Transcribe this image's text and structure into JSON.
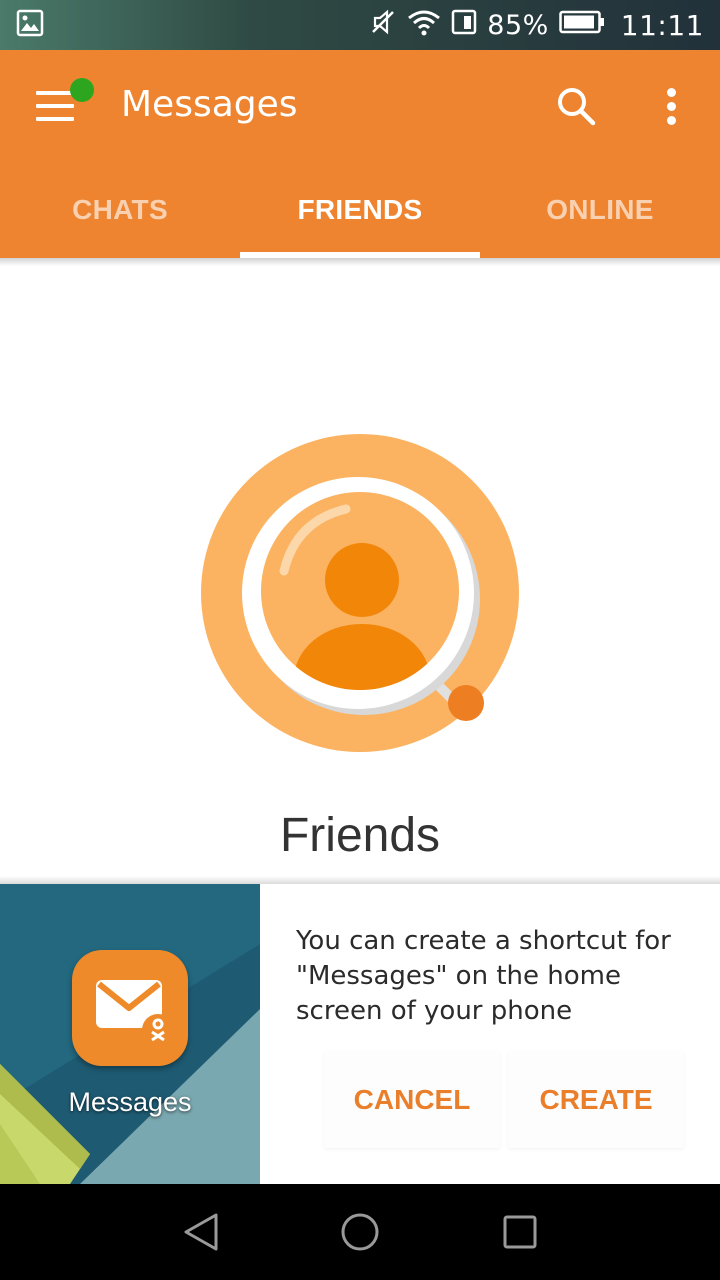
{
  "status_bar": {
    "battery_percent": "85%",
    "time": "11:11",
    "icons": [
      "gallery-icon",
      "mute-icon",
      "wifi-icon",
      "sim-icon",
      "battery-icon"
    ]
  },
  "app_bar": {
    "title": "Messages",
    "menu_icon": "hamburger-menu-icon",
    "search_icon": "search-icon",
    "more_icon": "more-vert-icon",
    "notification_dot_color": "#2ea51e",
    "background_color": "#ee8430"
  },
  "tabs": [
    {
      "label": "CHATS",
      "active": false
    },
    {
      "label": "FRIENDS",
      "active": true
    },
    {
      "label": "ONLINE",
      "active": false
    }
  ],
  "empty_state": {
    "illustration": "friends-search-illustration",
    "title": "Friends"
  },
  "shortcut_prompt": {
    "app_icon": "messages-app-icon",
    "app_label": "Messages",
    "message": "You can create a shortcut for \"Messages\" on the home screen of your phone",
    "cancel_label": "CANCEL",
    "create_label": "CREATE",
    "accent_color": "#ea7f2b"
  },
  "nav_bar": {
    "icons": [
      "back-icon",
      "home-icon",
      "recents-icon"
    ]
  }
}
